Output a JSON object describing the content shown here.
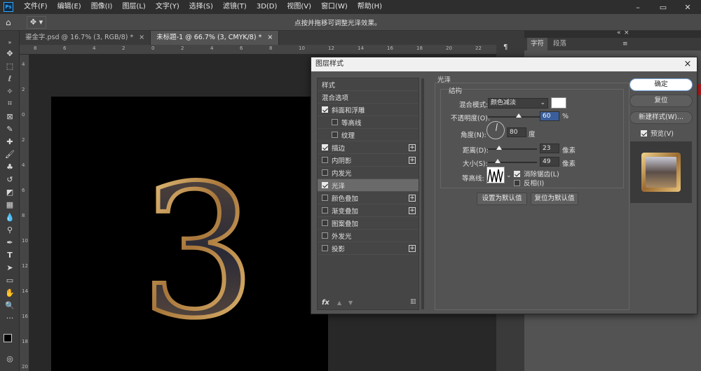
{
  "menubar": {
    "logo": "Ps",
    "items": [
      "文件(F)",
      "编辑(E)",
      "图像(I)",
      "图层(L)",
      "文字(Y)",
      "选择(S)",
      "滤镜(T)",
      "3D(D)",
      "视图(V)",
      "窗口(W)",
      "帮助(H)"
    ]
  },
  "optionsbar": {
    "hint": "点按并拖移可调整光泽效果。"
  },
  "tabs": [
    {
      "label": "鎏金字.psd @ 16.7% (3, RGB/8) *",
      "close": "×"
    },
    {
      "label": "未标题-1 @ 66.7% (3, CMYK/8) *",
      "close": "×"
    }
  ],
  "ruler": {
    "top_marks": [
      "8",
      "6",
      "4",
      "2",
      "0",
      "2",
      "4",
      "6",
      "8",
      "10",
      "12",
      "14",
      "16",
      "18",
      "20",
      "22"
    ],
    "left_marks": [
      "4",
      "2",
      "0",
      "2",
      "4",
      "6",
      "8",
      "10",
      "12",
      "14",
      "16",
      "18",
      "20"
    ]
  },
  "canvas": {
    "glyph": "3"
  },
  "right_panel": {
    "tabs": [
      "字符",
      "段落"
    ],
    "ctrl_symbols": [
      "«",
      "×"
    ]
  },
  "dialog": {
    "title": "图层样式",
    "close": "×",
    "style_list": [
      {
        "label": "样式",
        "checkbox": false,
        "checked": false,
        "indent": false,
        "plus": false,
        "selected": false
      },
      {
        "label": "混合选项",
        "checkbox": false,
        "checked": false,
        "indent": false,
        "plus": false,
        "selected": false
      },
      {
        "label": "斜面和浮雕",
        "checkbox": true,
        "checked": true,
        "indent": false,
        "plus": false,
        "selected": false
      },
      {
        "label": "等高线",
        "checkbox": true,
        "checked": false,
        "indent": true,
        "plus": false,
        "selected": false
      },
      {
        "label": "纹理",
        "checkbox": true,
        "checked": false,
        "indent": true,
        "plus": false,
        "selected": false
      },
      {
        "label": "描边",
        "checkbox": true,
        "checked": true,
        "indent": false,
        "plus": true,
        "selected": false
      },
      {
        "label": "内阴影",
        "checkbox": true,
        "checked": false,
        "indent": false,
        "plus": true,
        "selected": false
      },
      {
        "label": "内发光",
        "checkbox": true,
        "checked": false,
        "indent": false,
        "plus": false,
        "selected": false
      },
      {
        "label": "光泽",
        "checkbox": true,
        "checked": true,
        "indent": false,
        "plus": false,
        "selected": true
      },
      {
        "label": "颜色叠加",
        "checkbox": true,
        "checked": false,
        "indent": false,
        "plus": true,
        "selected": false
      },
      {
        "label": "渐变叠加",
        "checkbox": true,
        "checked": false,
        "indent": false,
        "plus": true,
        "selected": false
      },
      {
        "label": "图案叠加",
        "checkbox": true,
        "checked": false,
        "indent": false,
        "plus": false,
        "selected": false
      },
      {
        "label": "外发光",
        "checkbox": true,
        "checked": false,
        "indent": false,
        "plus": false,
        "selected": false
      },
      {
        "label": "投影",
        "checkbox": true,
        "checked": false,
        "indent": false,
        "plus": true,
        "selected": false
      }
    ],
    "list_footer": {
      "fx": "fx",
      "up": "▲",
      "down": "▼",
      "trash": "🗑"
    },
    "section_title": "光泽",
    "group_title": "结构",
    "blend_mode": {
      "label": "混合模式:",
      "value": "颜色减淡",
      "color": "#ffffff"
    },
    "opacity": {
      "label": "不透明度(O):",
      "value": "60",
      "unit": "%",
      "percent": 60
    },
    "angle": {
      "label": "角度(N):",
      "value": "80",
      "unit": "度"
    },
    "distance": {
      "label": "距离(D):",
      "value": "23",
      "unit": "像素",
      "fraction": 0.23
    },
    "size": {
      "label": "大小(S):",
      "value": "49",
      "unit": "像素",
      "fraction": 0.2
    },
    "contour": {
      "label": "等高线:"
    },
    "antialias": {
      "label": "消除锯齿(L)",
      "checked": true
    },
    "invert": {
      "label": "反相(I)",
      "checked": false
    },
    "set_default": "设置为默认值",
    "reset_default": "复位为默认值",
    "ok": "确定",
    "reset": "复位",
    "new_style": "新建样式(W)...",
    "preview": {
      "label": "预览(V)",
      "checked": true
    }
  }
}
